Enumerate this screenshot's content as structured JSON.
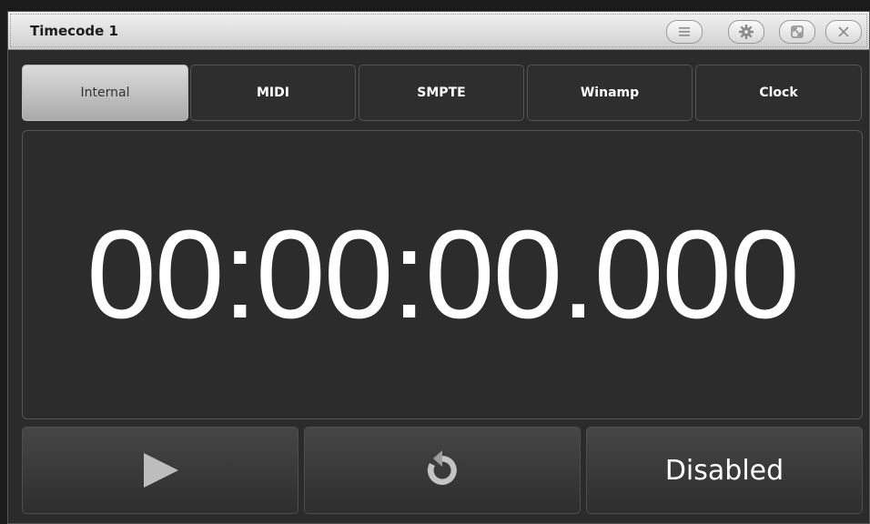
{
  "window": {
    "title": "Timecode 1"
  },
  "titlebar_icons": [
    "menu-icon",
    "gear-icon",
    "restore-icon",
    "close-icon"
  ],
  "tabs": [
    {
      "label": "Internal",
      "active": true
    },
    {
      "label": "MIDI",
      "active": false
    },
    {
      "label": "SMPTE",
      "active": false
    },
    {
      "label": "Winamp",
      "active": false
    },
    {
      "label": "Clock",
      "active": false
    }
  ],
  "display": {
    "timecode": "00:00:00.000"
  },
  "controls": {
    "play_icon": "play-icon",
    "reset_icon": "reset-icon",
    "status_label": "Disabled"
  },
  "colors": {
    "background": "#2b2b2b",
    "active_tab": "#c8c8c8",
    "text": "#ffffff"
  }
}
